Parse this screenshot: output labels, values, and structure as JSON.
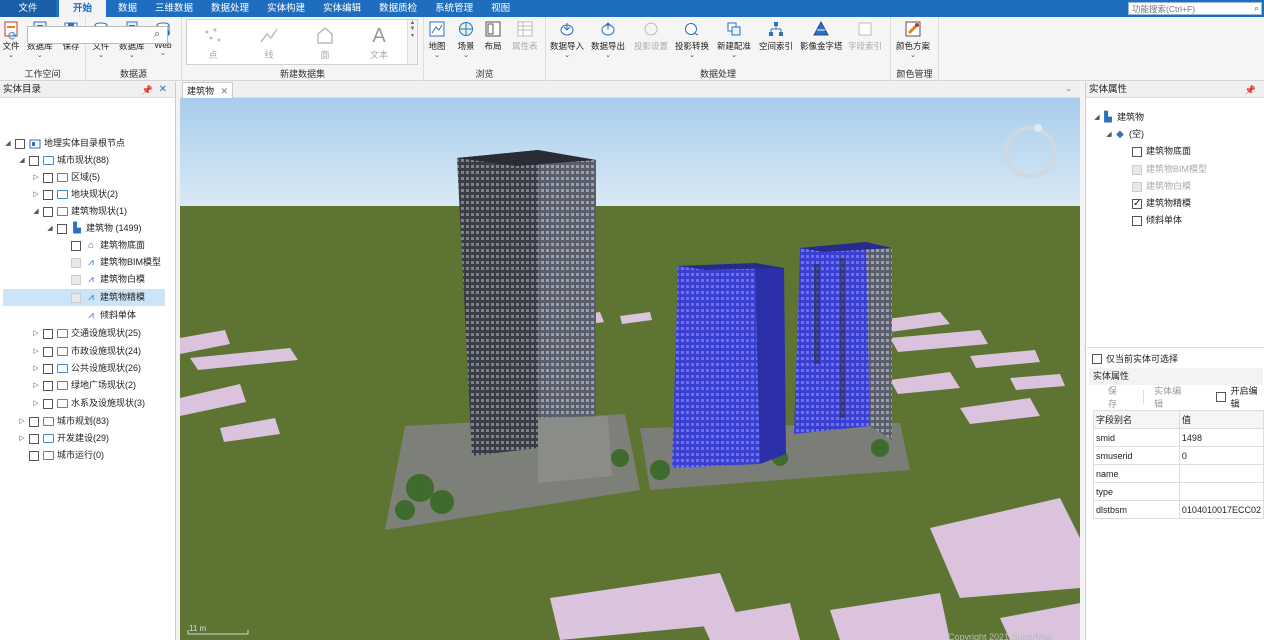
{
  "menu": {
    "items": [
      "文件",
      "开始",
      "数据",
      "三维数据",
      "数据处理",
      "实体构建",
      "实体编辑",
      "数据质检",
      "系统管理",
      "视图"
    ],
    "active": "开始",
    "search_placeholder": "功能搜索(Ctrl+F)"
  },
  "ribbon": {
    "groups": {
      "workspace": "工作空间",
      "datasource": "数据源",
      "new_dataset": "新建数据集",
      "browse": "浏览",
      "data_processing": "数据处理",
      "color_management": "颜色管理"
    },
    "buttons": {
      "ws_file": "文件",
      "ws_database": "数据库",
      "ws_save": "保存",
      "ds_file": "文件",
      "ds_database": "数据库",
      "ds_web": "Web",
      "gallery_point": "点",
      "gallery_line": "线",
      "gallery_region": "面",
      "gallery_text": "文本",
      "map": "地图",
      "scene": "场景",
      "layout": "布局",
      "attr_table": "属性表",
      "data_import": "数据导入",
      "data_export": "数据导出",
      "proj_settings": "投影设置",
      "proj_convert": "投影转换",
      "new_registration": "新建配准",
      "spatial_index": "空间索引",
      "image_pyramid": "影像金字塔",
      "field_index": "字段索引",
      "color_scheme": "颜色方案"
    }
  },
  "left_panel": {
    "title": "实体目录",
    "tree": [
      {
        "label": "地理实体目录根节点"
      },
      {
        "label": "城市现状(88)"
      },
      {
        "label": "区域(5)"
      },
      {
        "label": "地块现状(2)"
      },
      {
        "label": "建筑物现状(1)"
      },
      {
        "label": "建筑物 (1499)"
      },
      {
        "label": "建筑物底面"
      },
      {
        "label": "建筑物BIM模型"
      },
      {
        "label": "建筑物白模"
      },
      {
        "label": "建筑物精模"
      },
      {
        "label": "倾斜单体"
      },
      {
        "label": "交通设施现状(25)"
      },
      {
        "label": "市政设施现状(24)"
      },
      {
        "label": "公共设施现状(26)"
      },
      {
        "label": "绿地广场现状(2)"
      },
      {
        "label": "水系及设施现状(3)"
      },
      {
        "label": "城市规划(83)"
      },
      {
        "label": "开发建设(29)"
      },
      {
        "label": "城市运行(0)"
      }
    ]
  },
  "document": {
    "tab": "建筑物"
  },
  "scene": {
    "scale_text": "11 m",
    "copyright": "Copyright 2021 SuperMap"
  },
  "right_panel": {
    "title": "实体属性",
    "tree": [
      {
        "label": "建筑物"
      },
      {
        "label": "(空)"
      },
      {
        "label": "建筑物底面"
      },
      {
        "label": "建筑物BIM模型"
      },
      {
        "label": "建筑物白模"
      },
      {
        "label": "建筑物精模"
      },
      {
        "label": "倾斜单体"
      }
    ],
    "only_visible": "仅当前实体可选择",
    "props_header": "实体属性",
    "save": "保存",
    "edit": "实体编辑",
    "open_edit": "开启编辑",
    "table_headers": [
      "字段别名",
      "值"
    ],
    "rows": [
      {
        "field": "smid",
        "value": "1498"
      },
      {
        "field": "smuserid",
        "value": "0"
      },
      {
        "field": "name",
        "value": ""
      },
      {
        "field": "type",
        "value": ""
      },
      {
        "field": "dlstbsm",
        "value": "0104010017ECC02"
      }
    ]
  }
}
